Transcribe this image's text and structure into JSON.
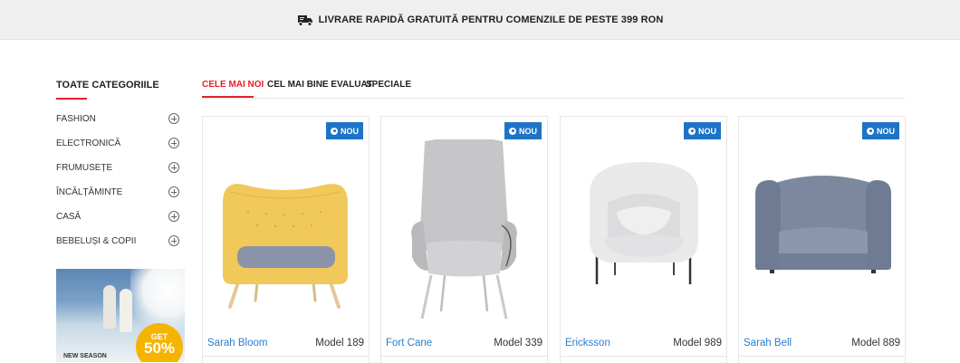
{
  "topbar": {
    "icon": "truck-icon",
    "text": "LIVRARE RAPIDĂ GRATUITĂ PENTRU COMENZILE DE PESTE 399 RON"
  },
  "sidebar": {
    "title": "TOATE CATEGORIILE",
    "accent_color": "#e5202a",
    "categories": [
      {
        "label": "FASHION",
        "icon": "plus-circle-icon"
      },
      {
        "label": "ELECTRONICĂ",
        "icon": "plus-circle-icon"
      },
      {
        "label": "FRUMUSEȚE",
        "icon": "plus-circle-icon"
      },
      {
        "label": "ÎNCĂLȚĂMINTE",
        "icon": "plus-circle-icon"
      },
      {
        "label": "CASĂ",
        "icon": "plus-circle-icon"
      },
      {
        "label": "BEBELUȘI & COPII",
        "icon": "plus-circle-icon"
      }
    ],
    "promo": {
      "season_text": "NEW SEASON",
      "get_text": "GET",
      "discount_text": "50%"
    }
  },
  "tabs": [
    {
      "label": "CELE MAI NOI",
      "active": true
    },
    {
      "label": "CEL MAI BINE EVALUAT",
      "active": false
    },
    {
      "label": "SPECIALE",
      "active": false
    }
  ],
  "products": [
    {
      "badge": "NOU",
      "name": "Sarah Bloom",
      "model": "Model 189"
    },
    {
      "badge": "NOU",
      "name": "Fort Cane",
      "model": "Model 339"
    },
    {
      "badge": "NOU",
      "name": "Ericksson",
      "model": "Model 989"
    },
    {
      "badge": "NOU",
      "name": "Sarah Bell",
      "model": "Model 889"
    }
  ],
  "colors": {
    "badge_blue": "#1d73c6",
    "link_blue": "#2a7fd0"
  }
}
